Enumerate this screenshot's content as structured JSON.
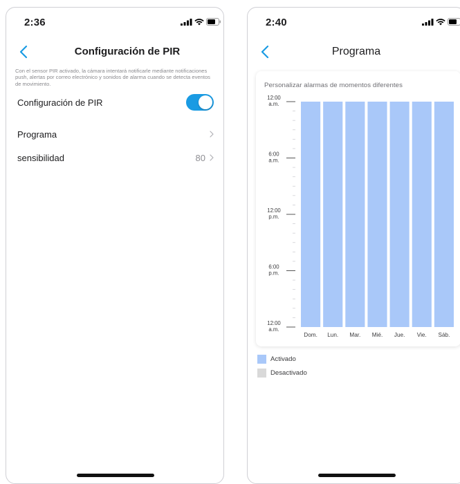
{
  "phone1": {
    "time": "2:36",
    "nav": {
      "title": "Configuración de PIR"
    },
    "description": "Con el sensor PIR activado, la cámara intentará notificarle mediante notificaciones push, alertas por correo electrónico y sonidos de alarma cuando se detecta eventos de movimiento.",
    "rows": [
      {
        "label": "Configuración de PIR",
        "control": "toggle",
        "on": true
      },
      {
        "label": "Programa",
        "value": ""
      },
      {
        "label": "sensibilidad",
        "value": "80"
      }
    ]
  },
  "phone2": {
    "time": "2:40",
    "nav": {
      "title": "Programa"
    },
    "card_title": "Personalizar alarmas de momentos diferentes",
    "legend": [
      {
        "label": "Activado",
        "color": "#a9c8f9"
      },
      {
        "label": "Desactivado",
        "color": "#d9d9d9"
      }
    ]
  },
  "colors": {
    "accent": "#1a9be3",
    "bar_active": "#a9c8f9",
    "bar_inactive": "#d9d9d9"
  },
  "chart_data": {
    "type": "bar",
    "title": "Personalizar alarmas de momentos diferentes",
    "categories": [
      "Dom.",
      "Lun.",
      "Mar.",
      "Mié.",
      "Jue.",
      "Vie.",
      "Sáb."
    ],
    "y_tick_labels": [
      [
        "12:00",
        "a.m."
      ],
      [
        "6:00",
        "a.m."
      ],
      [
        "12:00",
        "p.m."
      ],
      [
        "6:00",
        "p.m."
      ],
      [
        "12:00",
        "a.m."
      ]
    ],
    "y_range_hours": [
      0,
      24
    ],
    "series": [
      {
        "name": "Activado",
        "active_from": [
          0,
          0,
          0,
          0,
          0,
          0,
          0
        ],
        "active_to": [
          24,
          24,
          24,
          24,
          24,
          24,
          24
        ]
      }
    ],
    "legend_position": "bottom-left"
  }
}
